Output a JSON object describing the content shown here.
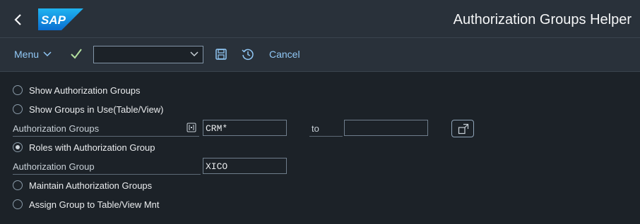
{
  "header": {
    "logo_text": "SAP",
    "title": "Authorization Groups Helper"
  },
  "toolbar": {
    "menu_label": "Menu",
    "command_field_value": "",
    "cancel_label": "Cancel"
  },
  "options": [
    {
      "label": "Show Authorization Groups",
      "selected": false
    },
    {
      "label": "Show Groups in Use(Table/View)",
      "selected": false
    },
    {
      "label": "Roles with Authorization Group",
      "selected": true
    },
    {
      "label": "Maintain Authorization Groups",
      "selected": false
    },
    {
      "label": "Assign Group to Table/View Mnt",
      "selected": false
    }
  ],
  "fields": {
    "auth_groups": {
      "label": "Authorization Groups",
      "value": "CRM*",
      "to_label": "to",
      "to_value": ""
    },
    "auth_group": {
      "label": "Authorization Group",
      "value": "XICO"
    }
  },
  "icons": [
    "back-icon",
    "checkmark-icon",
    "chevron-down-icon",
    "save-icon",
    "history-icon",
    "multiple-selection-icon",
    "value-help-icon"
  ],
  "colors": {
    "background": "#1c2228",
    "shell": "#29313a",
    "link": "#91c8f6",
    "check": "#b4e1a0"
  }
}
